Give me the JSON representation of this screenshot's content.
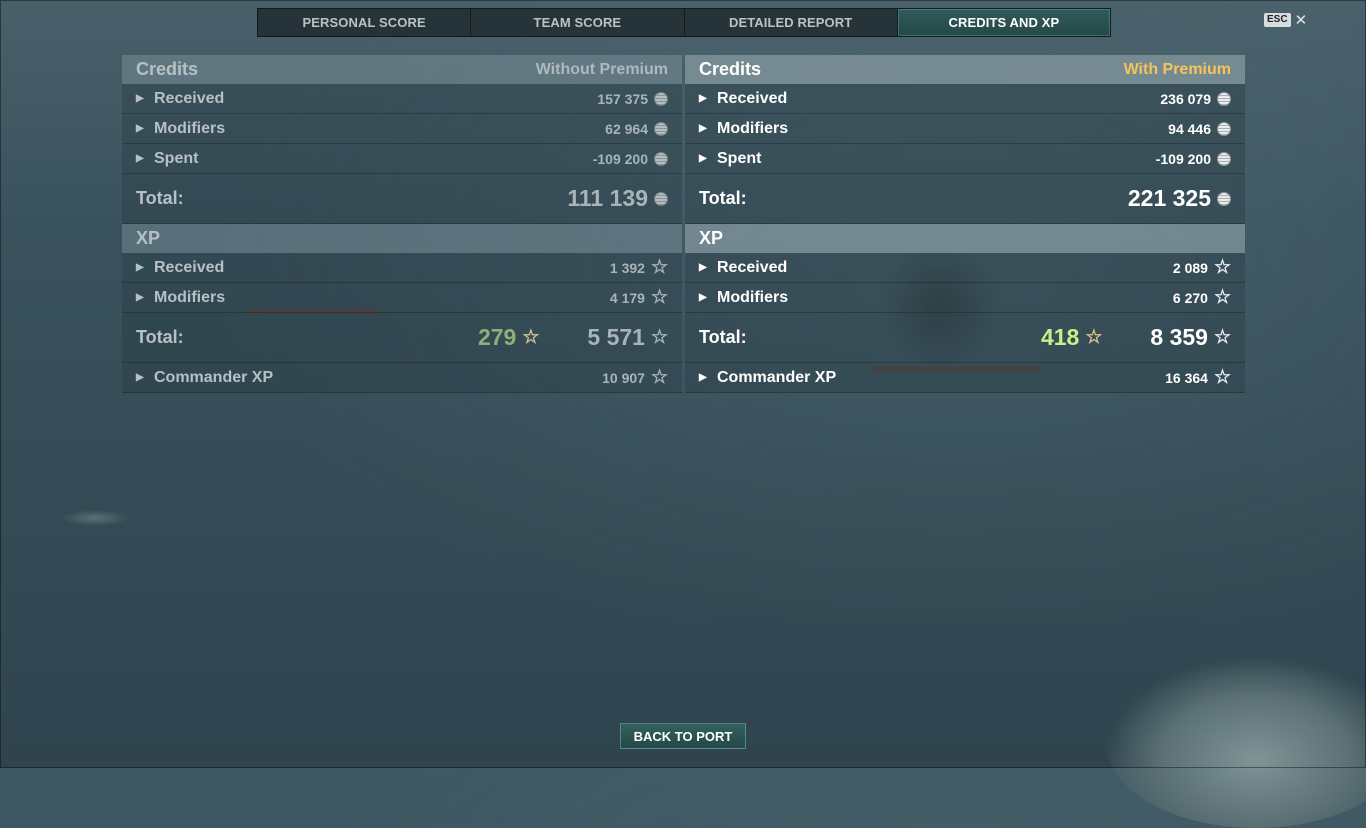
{
  "tabs": [
    {
      "label": "PERSONAL SCORE"
    },
    {
      "label": "TEAM SCORE"
    },
    {
      "label": "DETAILED REPORT"
    },
    {
      "label": "CREDITS AND XP"
    }
  ],
  "esc": {
    "key": "ESC",
    "close": "✕"
  },
  "left": {
    "credits": {
      "title": "Credits",
      "subtitle": "Without Premium",
      "rows": [
        {
          "label": "Received",
          "value": "157 375"
        },
        {
          "label": "Modifiers",
          "value": "62 964"
        },
        {
          "label": "Spent",
          "value": "-109 200"
        }
      ],
      "total_label": "Total:",
      "total_value": "111 139"
    },
    "xp": {
      "title": "XP",
      "rows": [
        {
          "label": "Received",
          "value": "1 392"
        },
        {
          "label": "Modifiers",
          "value": "4 179"
        }
      ],
      "total_label": "Total:",
      "premium_value": "279",
      "total_value": "5 571",
      "commander_label": "Commander XP",
      "commander_value": "10 907"
    }
  },
  "right": {
    "credits": {
      "title": "Credits",
      "subtitle": "With Premium",
      "rows": [
        {
          "label": "Received",
          "value": "236 079"
        },
        {
          "label": "Modifiers",
          "value": "94 446"
        },
        {
          "label": "Spent",
          "value": "-109 200"
        }
      ],
      "total_label": "Total:",
      "total_value": "221 325"
    },
    "xp": {
      "title": "XP",
      "rows": [
        {
          "label": "Received",
          "value": "2 089"
        },
        {
          "label": "Modifiers",
          "value": "6 270"
        }
      ],
      "total_label": "Total:",
      "premium_value": "418",
      "total_value": "8 359",
      "commander_label": "Commander XP",
      "commander_value": "16 364"
    }
  },
  "back_button": {
    "label": "BACK TO PORT"
  },
  "colors": {
    "premium_gold": "#f5c45a",
    "bonus_green": "#c9f08a",
    "active_tab": "#2b5050"
  },
  "icons": {
    "credit": "credits-coin-icon",
    "xp": "xp-star-icon",
    "expand": "expand-arrow-icon"
  }
}
